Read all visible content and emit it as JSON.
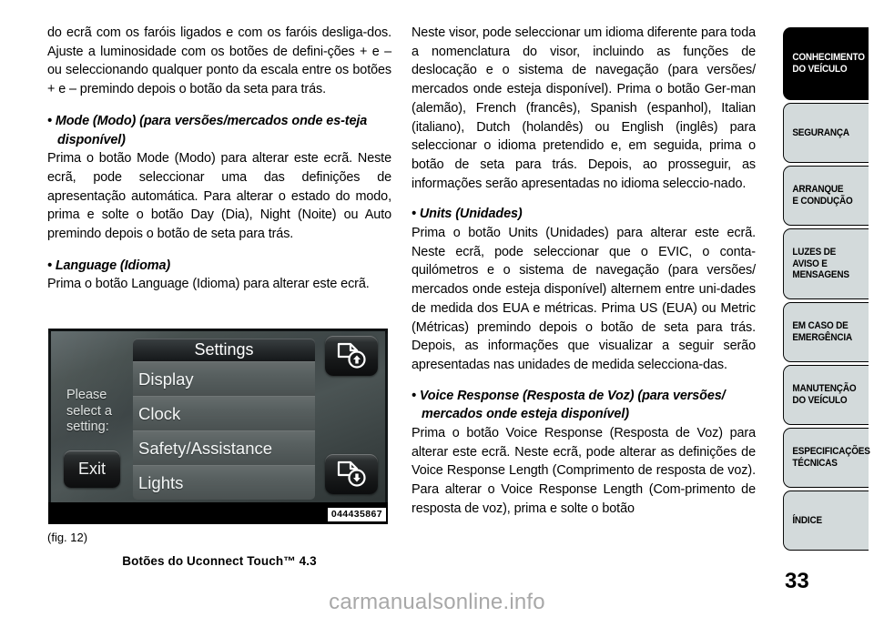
{
  "page_number": "33",
  "watermark": "carmanualsonline.info",
  "left_column": {
    "para1": "do ecrã com os faróis ligados e com os faróis desliga-dos. Ajuste a luminosidade com os botões de defini-ções + e – ou seleccionando qualquer ponto da escala entre os botões + e – premindo depois o botão da seta para trás.",
    "bullet1_heading": "• Mode (Modo) (para versões/mercados onde es-teja disponível)",
    "para2": "Prima o botão Mode (Modo) para alterar este ecrã. Neste ecrã, pode seleccionar uma das definições de apresentação automática. Para alterar o estado do modo, prima e solte o botão Day (Dia), Night (Noite) ou Auto premindo depois o botão de seta para trás.",
    "bullet2_heading": "• Language (Idioma)",
    "para3": "Prima o botão Language (Idioma) para alterar este ecrã."
  },
  "right_column": {
    "para1": "Neste visor, pode seleccionar um idioma diferente para toda a nomenclatura do visor, incluindo as funções de deslocação e o sistema de navegação (para versões/ mercados onde esteja disponível). Prima o botão Ger-man (alemão), French (francês), Spanish (espanhol), Italian (italiano), Dutch (holandês) ou English (inglês) para seleccionar o idioma pretendido e, em seguida, prima o botão de seta para trás. Depois, ao prosseguir, as informações serão apresentadas no idioma seleccio-nado.",
    "bullet1_heading": "• Units (Unidades)",
    "para2": "Prima o botão Units (Unidades) para alterar este ecrã. Neste ecrã, pode seleccionar que o EVIC, o conta-quilómetros e o sistema de navegação (para versões/ mercados onde esteja disponível) alternem entre uni-dades de medida dos EUA e métricas. Prima US (EUA) ou Metric (Métricas) premindo depois o botão de seta para trás. Depois, as informações que visualizar a seguir serão apresentadas nas unidades de medida selecciona-das.",
    "bullet2_heading": "• Voice Response (Resposta de Voz) (para versões/ mercados onde esteja disponível)",
    "para3": "Prima o botão Voice Response (Resposta de Voz) para alterar este ecrã. Neste ecrã, pode alterar as definições de Voice Response Length (Comprimento de resposta de voz). Para alterar o Voice Response Length (Com-primento de resposta de voz), prima e solte o botão"
  },
  "figure": {
    "label": "(fig. 12)",
    "caption": "Botões do Uconnect Touch™ 4.3",
    "image_code": "044435867",
    "screen": {
      "prompt": "Please select a setting:",
      "exit_label": "Exit",
      "menu_title": "Settings",
      "menu_items": [
        "Display",
        "Clock",
        "Safety/Assistance",
        "Lights"
      ],
      "page_up_icon": "page-up-icon",
      "page_down_icon": "page-down-icon"
    }
  },
  "sidebar": {
    "tabs": [
      {
        "line1": "CONHECIMENTO",
        "line2": "DO VEÍCULO",
        "active": true
      },
      {
        "line1": "SEGURANÇA",
        "line2": "",
        "active": false
      },
      {
        "line1": "ARRANQUE",
        "line2": "E CONDUÇÃO",
        "active": false
      },
      {
        "line1": "LUZES DE",
        "line2": "AVISO E",
        "line3": "MENSAGENS",
        "active": false
      },
      {
        "line1": "EM CASO DE",
        "line2": "EMERGÊNCIA",
        "active": false
      },
      {
        "line1": "MANUTENÇÃO",
        "line2": "DO VEÍCULO",
        "active": false
      },
      {
        "line1": "ESPECIFICAÇÕES",
        "line2": "TÉCNICAS",
        "active": false
      },
      {
        "line1": "ÍNDICE",
        "line2": "",
        "active": false
      }
    ]
  }
}
